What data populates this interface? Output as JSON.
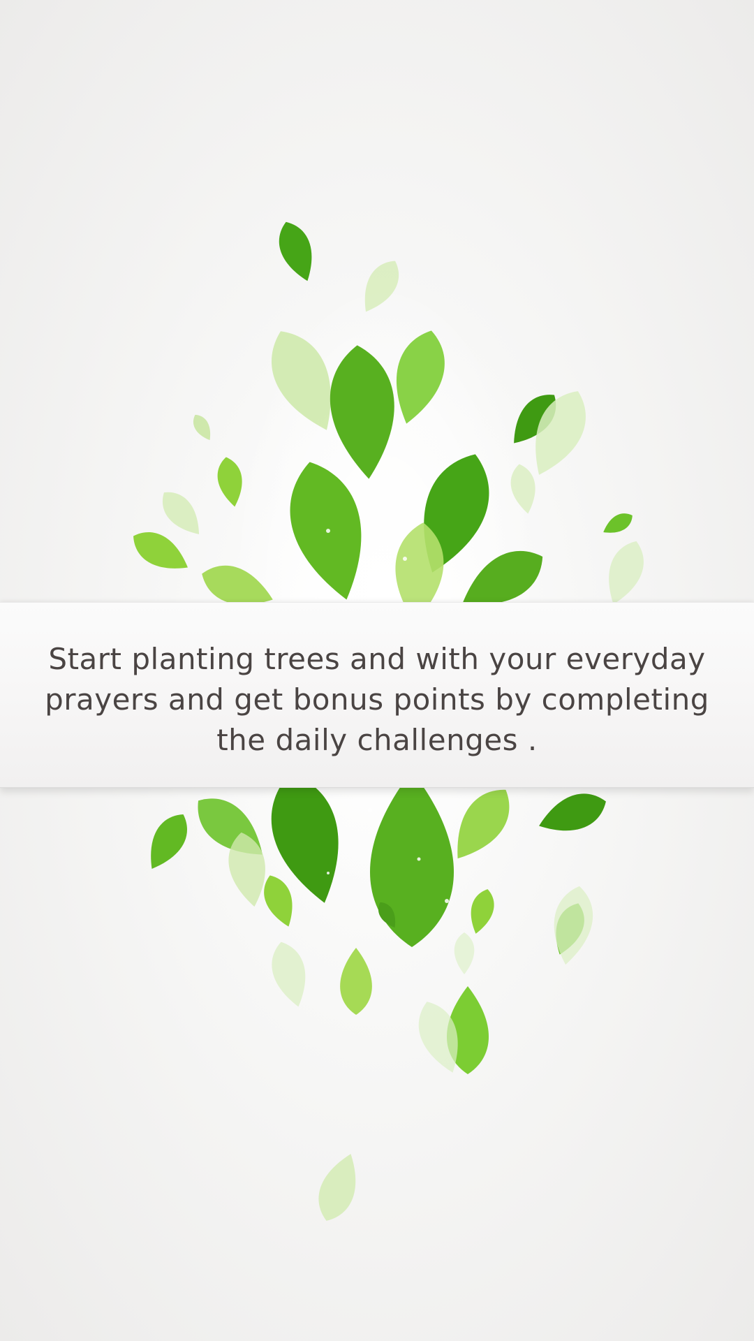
{
  "onboarding": {
    "message": "Start planting trees and with your everyday prayers and get bonus points by completing the daily challenges ."
  },
  "artwork": {
    "icon": "green-leaves-illustration",
    "colors": {
      "leaf_dark": "#3f9a12",
      "leaf_mid": "#6cc22a",
      "leaf_light": "#b6e07a",
      "text": "#4a4443"
    }
  }
}
